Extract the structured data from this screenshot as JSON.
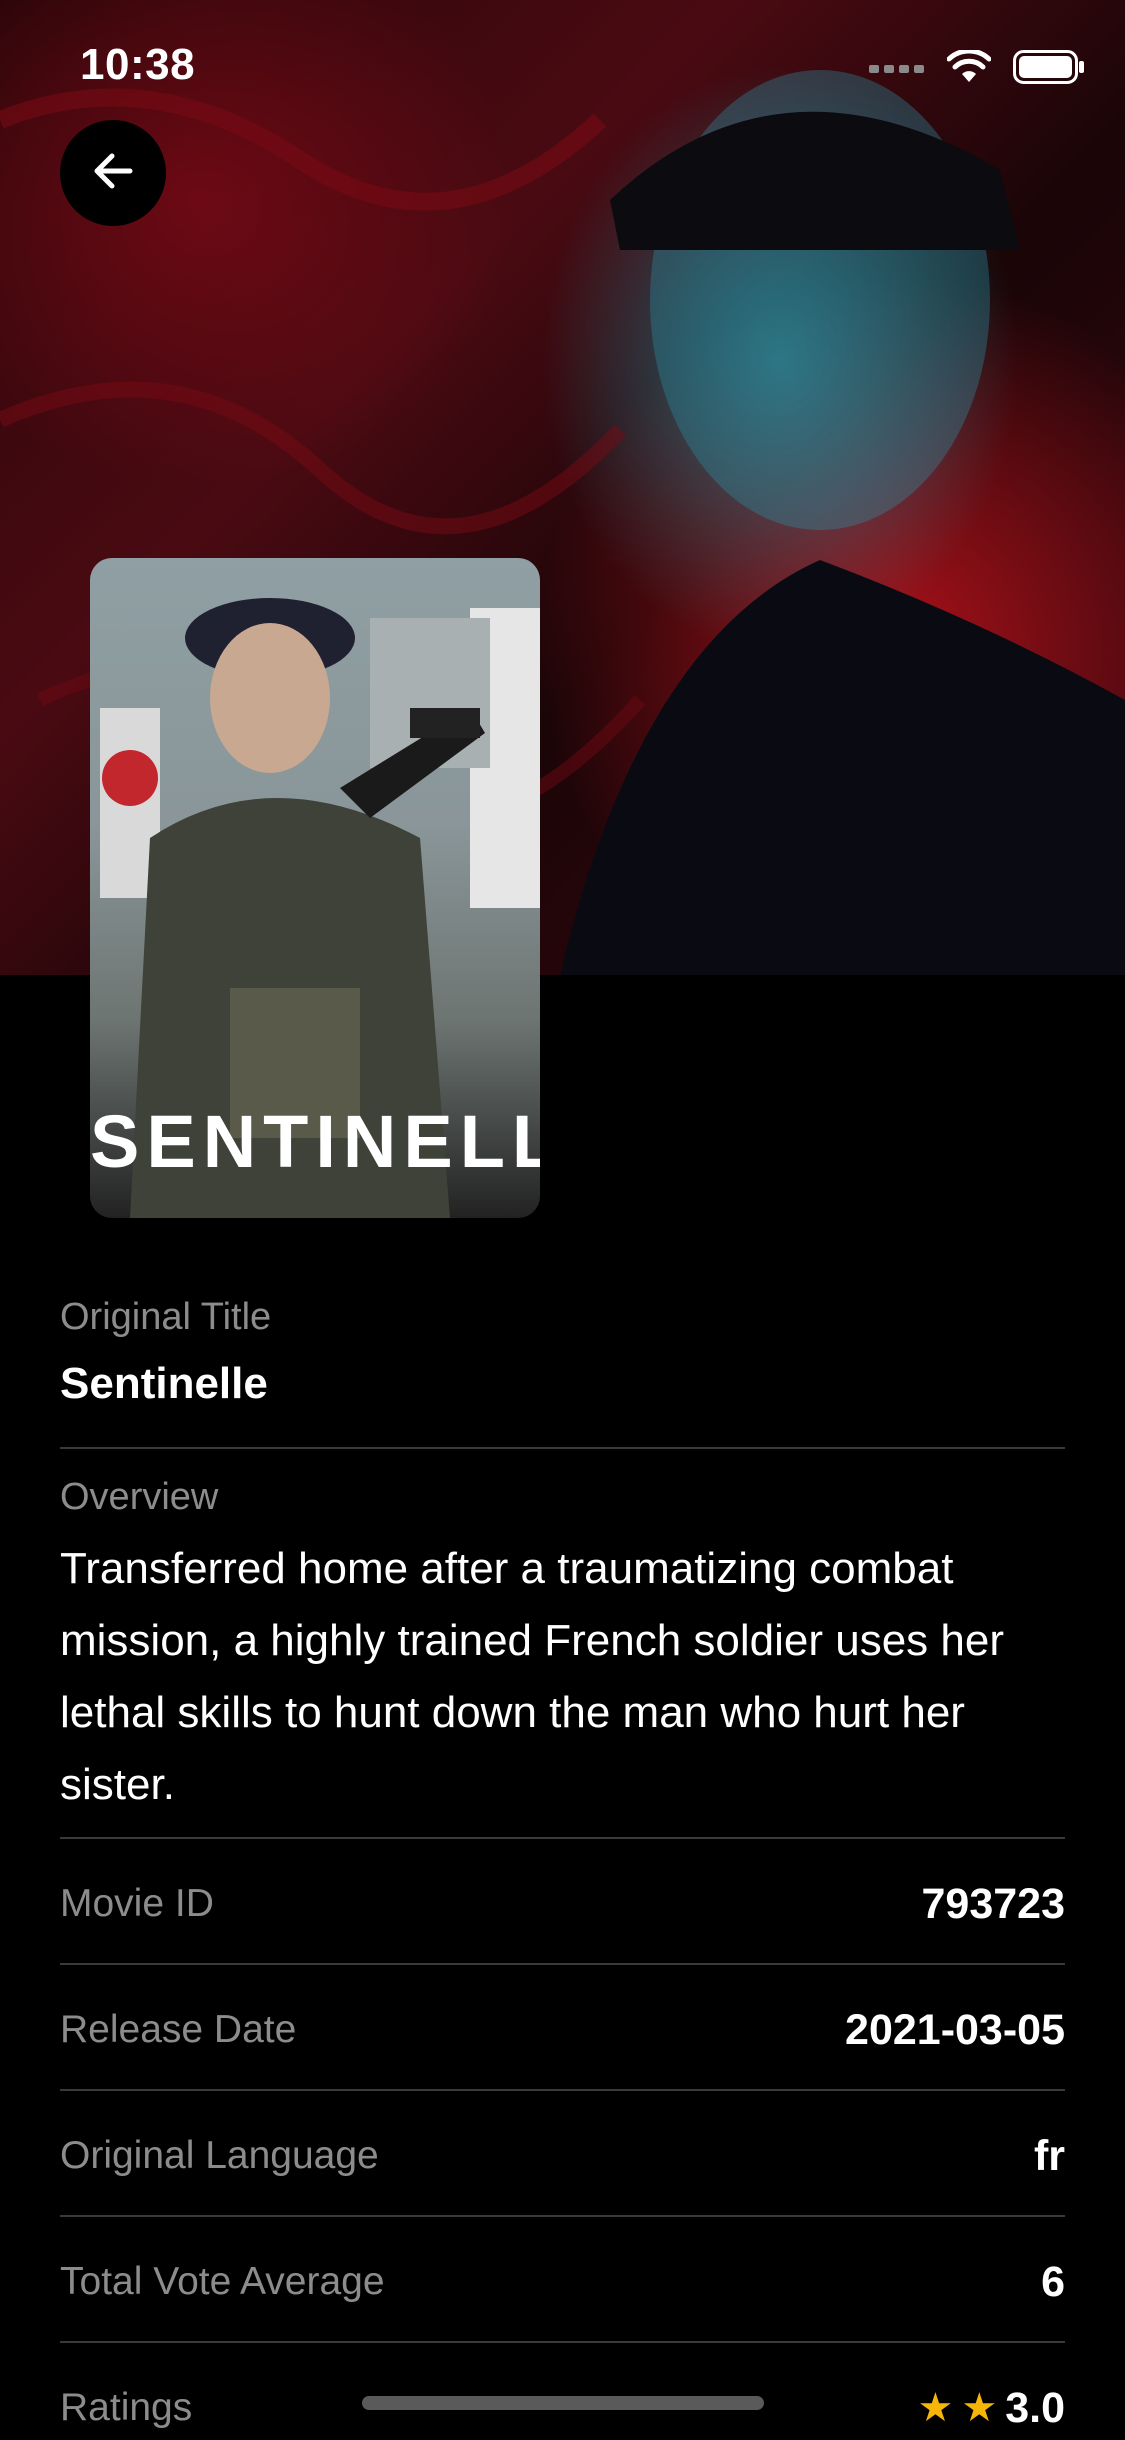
{
  "status_bar": {
    "time": "10:38"
  },
  "poster": {
    "title_text": "SENTINELLE"
  },
  "details": {
    "original_title_label": "Original Title",
    "original_title": "Sentinelle",
    "overview_label": "Overview",
    "overview": "Transferred home after a traumatizing combat mission, a highly trained French soldier uses her lethal skills to hunt down the man who hurt her sister.",
    "rows": [
      {
        "label": "Movie ID",
        "value": "793723"
      },
      {
        "label": "Release Date",
        "value": "2021-03-05"
      },
      {
        "label": "Original Language",
        "value": "fr"
      },
      {
        "label": "Total Vote Average",
        "value": "6"
      }
    ],
    "ratings_label": "Ratings",
    "ratings_value": "3.0",
    "ratings_stars": 2
  },
  "colors": {
    "accent_star": "#f5b50a",
    "divider": "#3a3a3a",
    "label": "#8c8c8c"
  }
}
